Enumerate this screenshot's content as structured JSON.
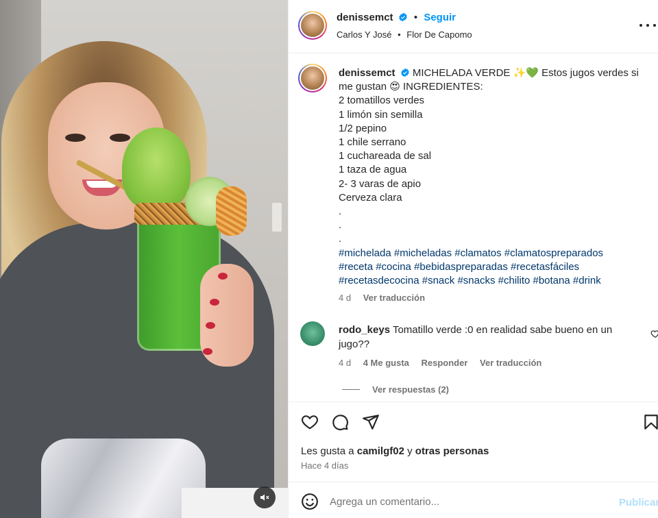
{
  "post": {
    "username": "denissemct",
    "follow_label": "Seguir",
    "location_1": "Carlos Y José",
    "location_2": "Flor De Capomo",
    "separator": "•"
  },
  "caption": {
    "username": "denissemct",
    "title_text": "MICHELADA VERDE ✨💚 Estos jugos verdes si me gustan 😍 INGREDIENTES:",
    "lines": [
      "2 tomatillos verdes",
      "1 limón sin semilla",
      "1/2 pepino",
      "1 chile serrano",
      "1 cuchareada de sal",
      "1 taza de agua",
      "2- 3 varas de apio",
      "Cerveza clara",
      ".",
      ".",
      "."
    ],
    "hashtags_1": "#michelada #micheladas #clamatos #clamatospreparados",
    "hashtags_2": "#receta #cocina #bebidaspreparadas #recetasfáciles",
    "hashtags_3": "#recetasdecocina #snack #snacks #chilito #botana #drink",
    "age": "4 d",
    "translate": "Ver traducción"
  },
  "comment": {
    "username": "rodo_keys",
    "text": "Tomatillo verde :0 en realidad sabe bueno en un jugo??",
    "age": "4 d",
    "likes": "4 Me gusta",
    "reply": "Responder",
    "translate": "Ver traducción",
    "view_replies": "Ver respuestas (2)"
  },
  "likes": {
    "prefix": "Les gusta a",
    "user": "camilgf02",
    "conj": "y",
    "others": "otras personas"
  },
  "time_ago": "Hace 4 días",
  "add_comment": {
    "placeholder": "Agrega un comentario...",
    "publish_label": "Publicar"
  },
  "colors": {
    "link_blue": "#0095f6",
    "hashtag": "#00376b",
    "muted": "#737373",
    "publish_disabled": "#b2dffc"
  },
  "icons": [
    "verified-badge-icon",
    "more-options-icon",
    "heart-icon",
    "comment-icon",
    "share-icon",
    "bookmark-icon",
    "emoji-icon",
    "mute-icon"
  ]
}
